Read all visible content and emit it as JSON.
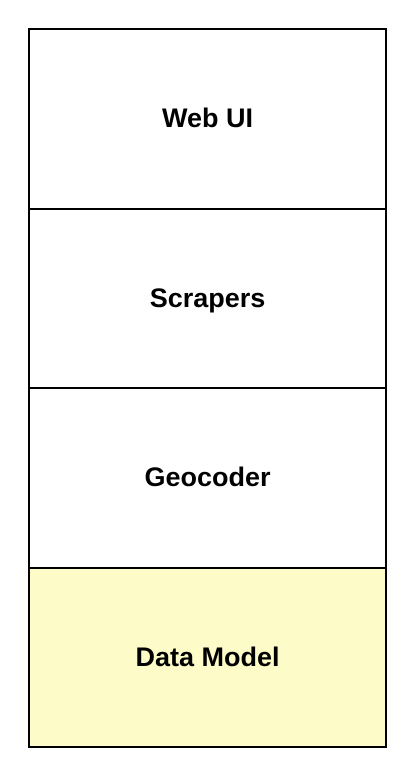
{
  "diagram": {
    "layers": [
      {
        "label": "Web UI",
        "fill": "#ffffff"
      },
      {
        "label": "Scrapers",
        "fill": "#ffffff"
      },
      {
        "label": "Geocoder",
        "fill": "#ffffff"
      },
      {
        "label": "Data Model",
        "fill": "#fdfbc7"
      }
    ],
    "border_color": "#000000"
  }
}
